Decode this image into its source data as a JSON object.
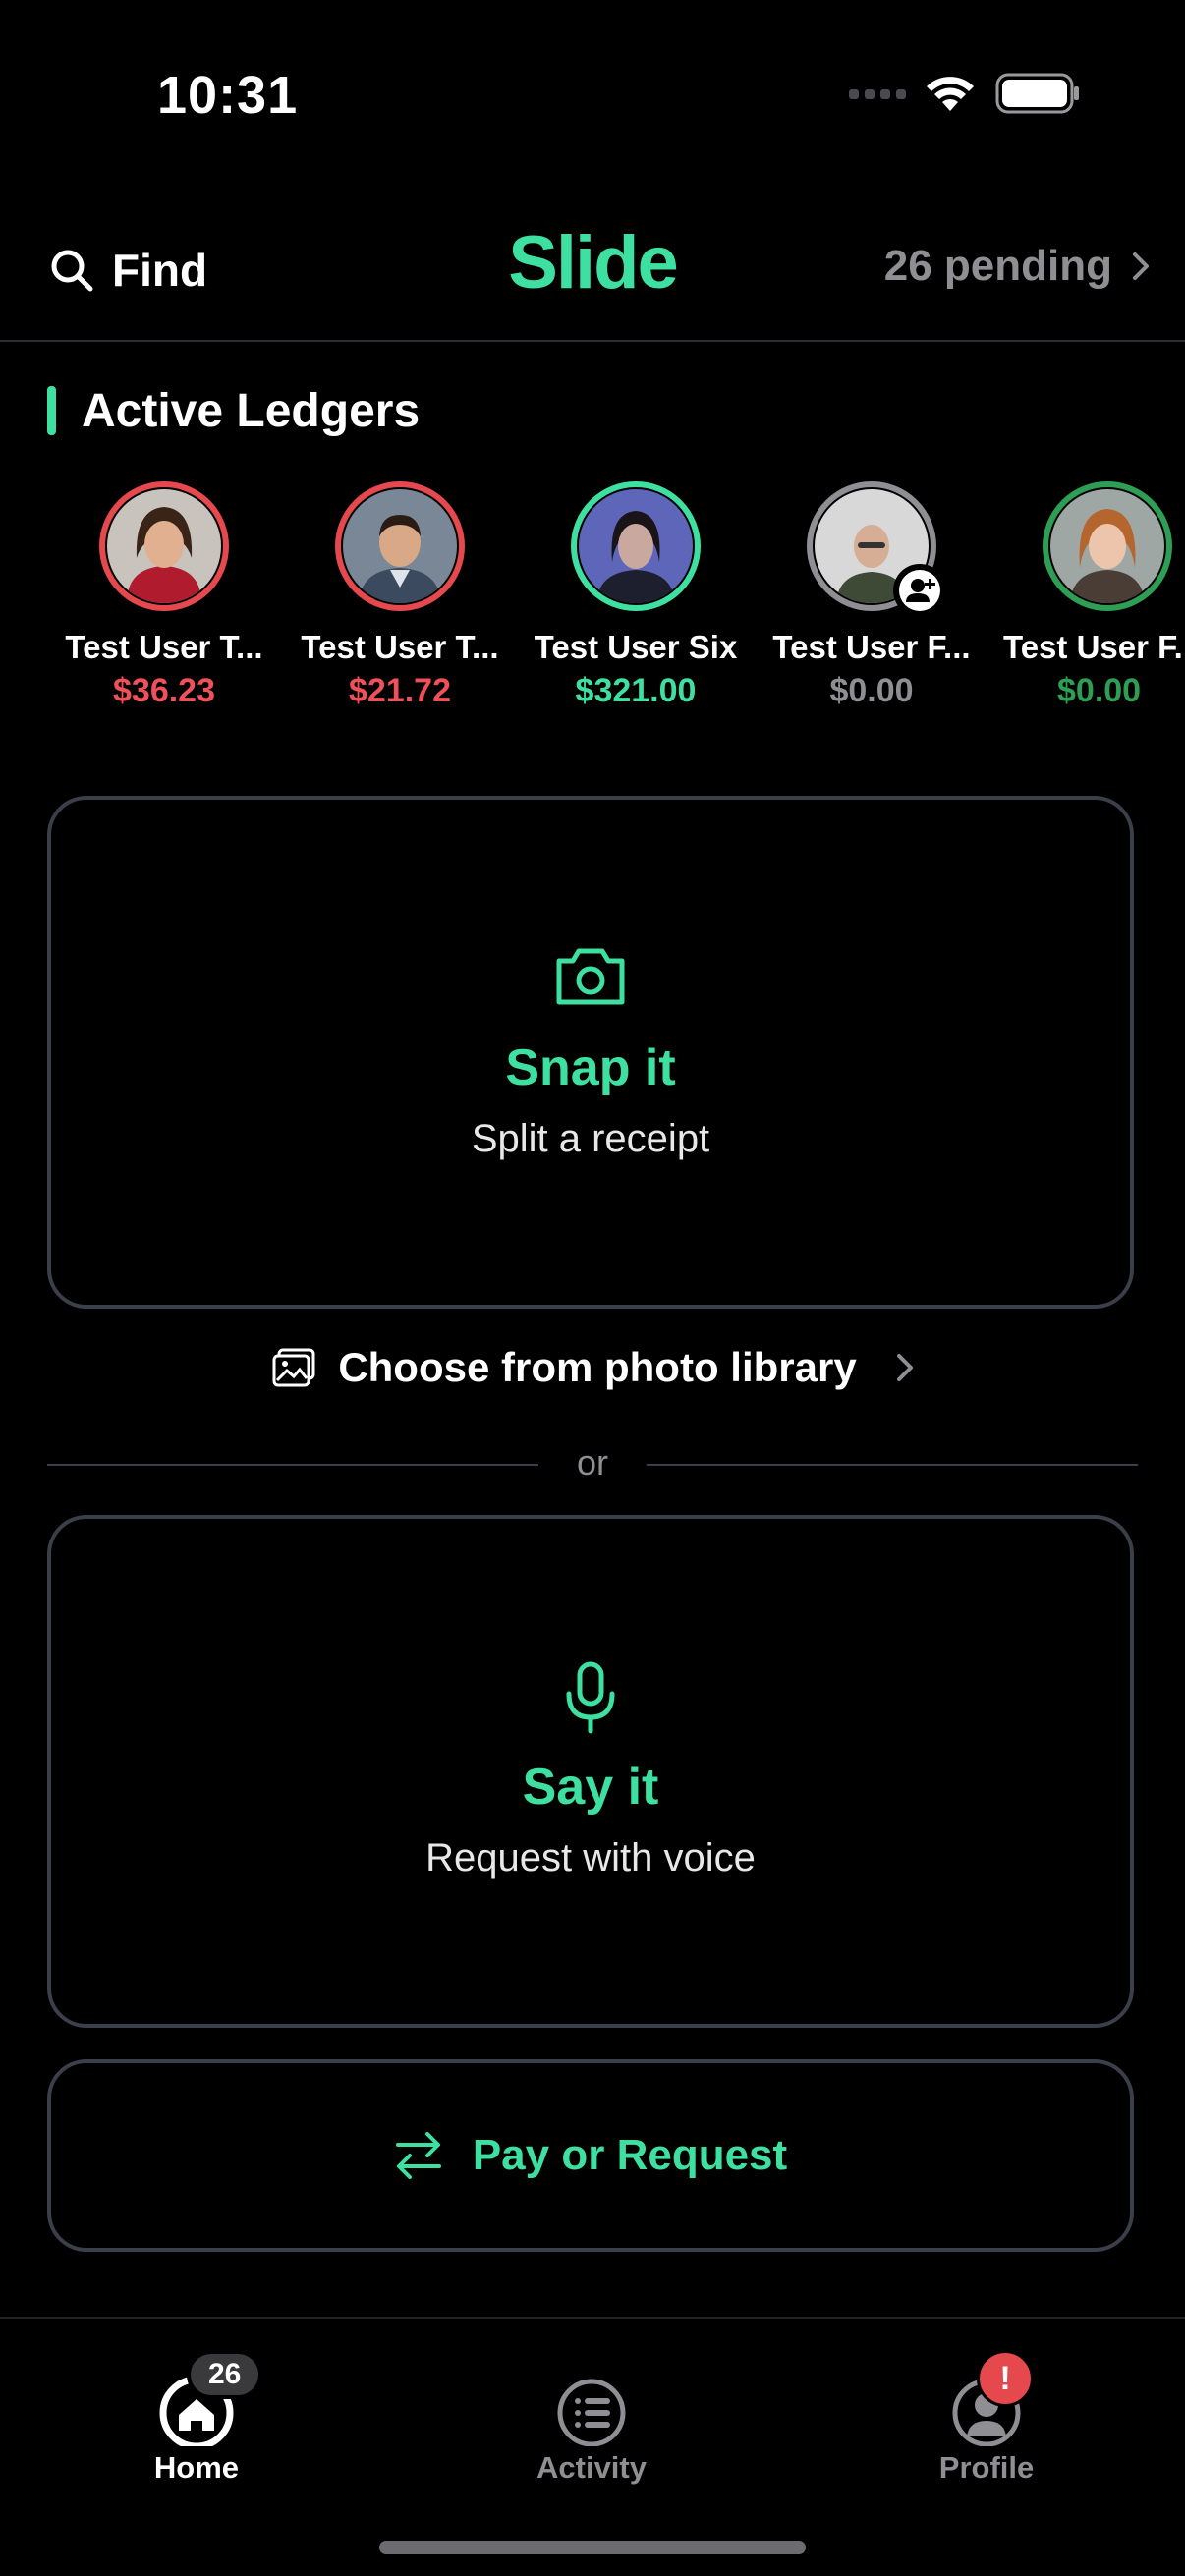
{
  "status_bar": {
    "time": "10:31"
  },
  "header": {
    "find_label": "Find",
    "logo": "Slide",
    "pending_label": "26 pending"
  },
  "section": {
    "title": "Active Ledgers"
  },
  "ledgers": [
    {
      "name": "Test User T...",
      "amount": "$36.23",
      "ring": "#e5484d",
      "amount_color": "#f0505a"
    },
    {
      "name": "Test User T...",
      "amount": "$21.72",
      "ring": "#e5484d",
      "amount_color": "#f0505a"
    },
    {
      "name": "Test User Six",
      "amount": "$321.00",
      "ring": "#3ee0a1",
      "amount_color": "#3ee0a1"
    },
    {
      "name": "Test User F...",
      "amount": "$0.00",
      "ring": "#8e8e93",
      "amount_color": "#8e8e93"
    },
    {
      "name": "Test User F...",
      "amount": "$0.00",
      "ring": "#2e9e55",
      "amount_color": "#2e9e55"
    }
  ],
  "snap_card": {
    "icon": "camera-icon",
    "title": "Snap it",
    "subtitle": "Split a receipt"
  },
  "library": {
    "icon": "photo-library-icon",
    "label": "Choose from photo library"
  },
  "divider": {
    "label": "or"
  },
  "say_card": {
    "icon": "microphone-icon",
    "title": "Say it",
    "subtitle": "Request with voice"
  },
  "pay_button": {
    "icon": "swap-arrows-icon",
    "label": "Pay or Request"
  },
  "tabs": [
    {
      "label": "Home",
      "icon": "home-icon",
      "badge": "26",
      "active": true
    },
    {
      "label": "Activity",
      "icon": "list-icon",
      "badge": "",
      "active": false
    },
    {
      "label": "Profile",
      "icon": "profile-icon",
      "badge": "!",
      "active": false
    }
  ],
  "colors": {
    "accent": "#3ee0a1",
    "negative": "#e5484d",
    "background": "#000000",
    "border": "#3a3f4a"
  }
}
